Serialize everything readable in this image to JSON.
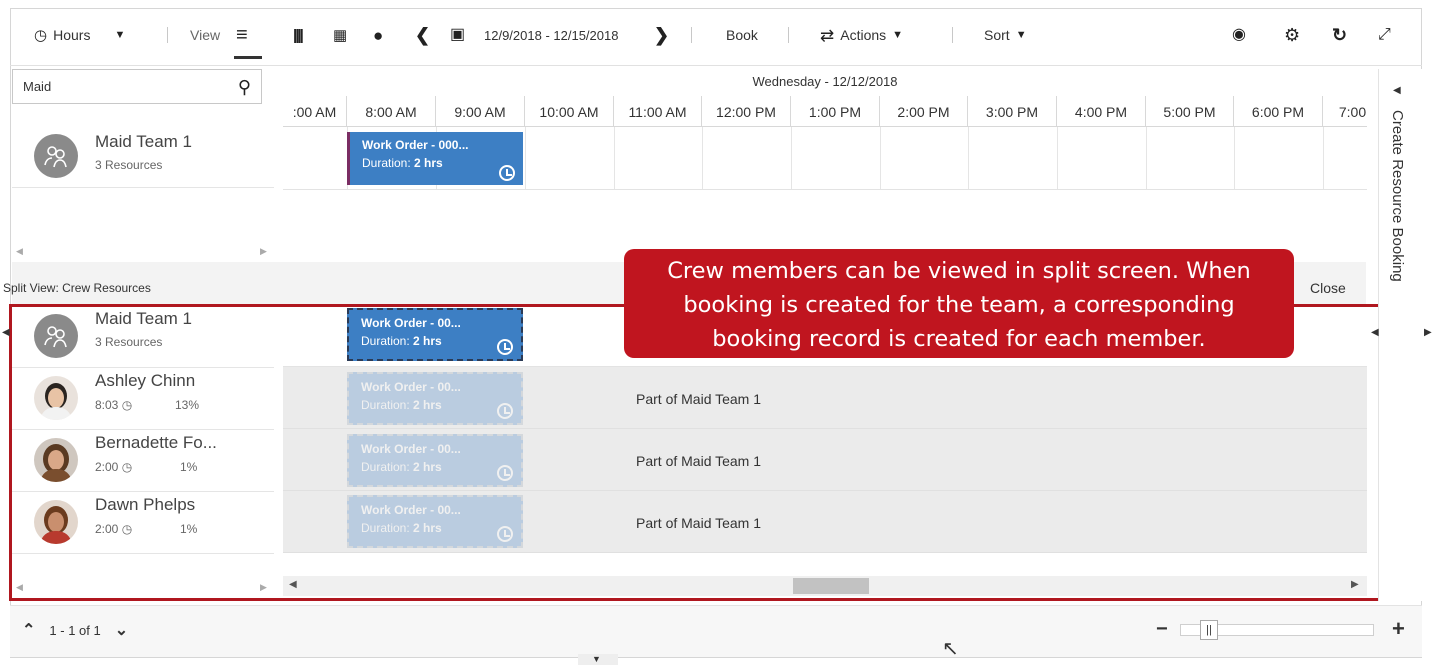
{
  "toolbar": {
    "hours_label": "Hours",
    "view_label": "View",
    "date_range": "12/9/2018 - 12/15/2018",
    "book_label": "Book",
    "actions_label": "Actions",
    "sort_label": "Sort"
  },
  "search": {
    "value": "Maid"
  },
  "schedule": {
    "date_header": "Wednesday - 12/12/2018",
    "hours": [
      ":00 AM",
      "8:00 AM",
      "9:00 AM",
      "10:00 AM",
      "11:00 AM",
      "12:00 PM",
      "1:00 PM",
      "2:00 PM",
      "3:00 PM",
      "4:00 PM",
      "5:00 PM",
      "6:00 PM",
      "7:00"
    ]
  },
  "upper_resources": [
    {
      "name": "Maid Team 1",
      "sub": "3 Resources"
    }
  ],
  "booking": {
    "title": "Work Order - 000...",
    "title_short": "Work Order - 00...",
    "duration_label": "Duration:",
    "duration_value": "2 hrs"
  },
  "split_view": {
    "label": "Split View: Crew Resources",
    "close_label": "Close",
    "team": {
      "name": "Maid Team 1",
      "sub": "3 Resources"
    },
    "members": [
      {
        "name": "Ashley Chinn",
        "time": "8:03",
        "pct": "13%",
        "part_of": "Part of Maid Team 1"
      },
      {
        "name": "Bernadette Fo...",
        "time": "2:00",
        "pct": "1%",
        "part_of": "Part of Maid Team 1"
      },
      {
        "name": "Dawn Phelps",
        "time": "2:00",
        "pct": "1%",
        "part_of": "Part of Maid Team 1"
      }
    ]
  },
  "callout": {
    "line1": "Crew members can be viewed in split screen.  When",
    "line2": "booking is created for the team, a corresponding",
    "line3": "booking record is created for each member."
  },
  "side_panel": {
    "label": "Create Resource Booking"
  },
  "pager": {
    "text": "1 - 1 of 1"
  },
  "colors": {
    "booking_blue": "#3d7fc4",
    "callout_red": "#c0151f",
    "outline_red": "#b0171f"
  }
}
